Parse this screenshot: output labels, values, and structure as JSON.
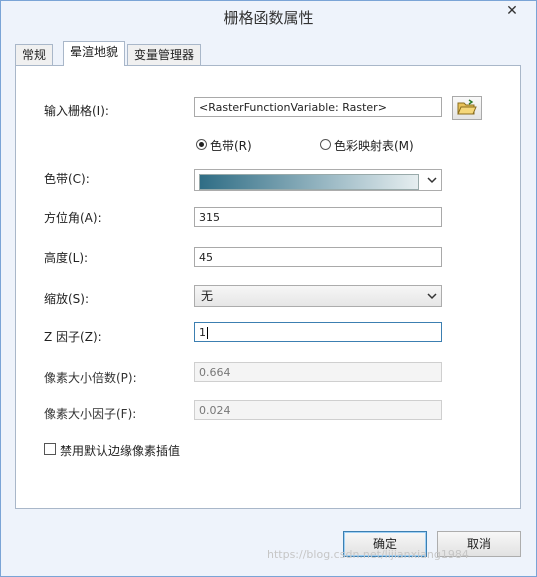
{
  "window": {
    "title": "栅格函数属性",
    "close_glyph": "✕"
  },
  "tabs": [
    {
      "label": "常规",
      "active": false
    },
    {
      "label": "晕渲地貌",
      "active": true
    },
    {
      "label": "变量管理器",
      "active": false
    }
  ],
  "form": {
    "input_raster": {
      "label": "输入栅格(I):",
      "value": "<RasterFunctionVariable: Raster>"
    },
    "mode": {
      "color_ramp_option": {
        "label": "色带(R)",
        "selected": true
      },
      "colormap_option": {
        "label": "色彩映射表(M)",
        "selected": false
      }
    },
    "color_ramp": {
      "label": "色带(C):",
      "start_color": "#2f6d85",
      "end_color": "#e6eef0"
    },
    "azimuth": {
      "label": "方位角(A):",
      "value": "315"
    },
    "altitude": {
      "label": "高度(L):",
      "value": "45"
    },
    "scaling": {
      "label": "缩放(S):",
      "value": "无"
    },
    "z_factor": {
      "label": "Z 因子(Z):",
      "value": "1"
    },
    "pixel_size_power": {
      "label": "像素大小倍数(P):",
      "value": "0.664"
    },
    "pixel_size_factor": {
      "label": "像素大小因子(F):",
      "value": "0.024"
    },
    "remove_edge": {
      "label": "禁用默认边缘像素插值",
      "checked": false
    }
  },
  "buttons": {
    "ok": "确定",
    "cancel": "取消"
  },
  "watermark": "https://blog.csdn.net/lijianxiang1984",
  "colors": {
    "accent": "#3c7fb1",
    "window_border": "#7aa4d6",
    "window_bg": "#eef3fb"
  }
}
